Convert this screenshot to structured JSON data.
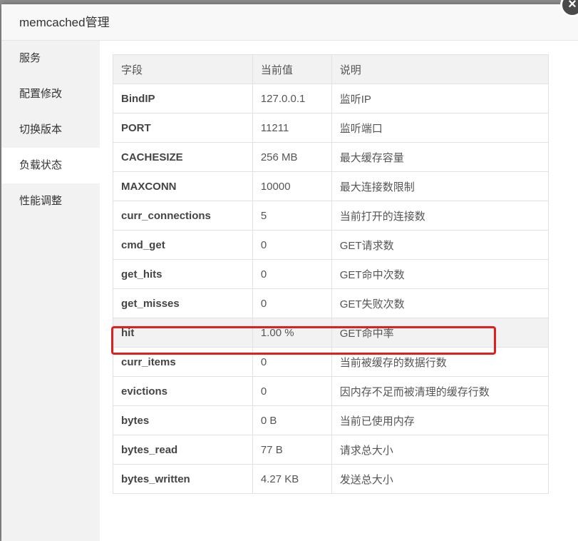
{
  "dialog": {
    "title": "memcached管理",
    "close_icon": "×"
  },
  "sidebar": {
    "items": [
      {
        "label": "服务"
      },
      {
        "label": "配置修改"
      },
      {
        "label": "切换版本"
      },
      {
        "label": "负载状态",
        "active": true
      },
      {
        "label": "性能调整"
      }
    ]
  },
  "table": {
    "headers": [
      "字段",
      "当前值",
      "说明"
    ],
    "rows": [
      {
        "field": "BindIP",
        "value": "127.0.0.1",
        "desc": "监听IP"
      },
      {
        "field": "PORT",
        "value": "11211",
        "desc": "监听端口"
      },
      {
        "field": "CACHESIZE",
        "value": "256 MB",
        "desc": "最大缓存容量"
      },
      {
        "field": "MAXCONN",
        "value": "10000",
        "desc": "最大连接数限制"
      },
      {
        "field": "curr_connections",
        "value": "5",
        "desc": "当前打开的连接数"
      },
      {
        "field": "cmd_get",
        "value": "0",
        "desc": "GET请求数"
      },
      {
        "field": "get_hits",
        "value": "0",
        "desc": "GET命中次数"
      },
      {
        "field": "get_misses",
        "value": "0",
        "desc": "GET失败次数"
      },
      {
        "field": "hit",
        "value": "1.00 %",
        "desc": "GET命中率"
      },
      {
        "field": "curr_items",
        "value": "0",
        "desc": "当前被缓存的数据行数"
      },
      {
        "field": "evictions",
        "value": "0",
        "desc": "因内存不足而被清理的缓存行数"
      },
      {
        "field": "bytes",
        "value": "0 B",
        "desc": "当前已使用内存"
      },
      {
        "field": "bytes_read",
        "value": "77 B",
        "desc": "请求总大小"
      },
      {
        "field": "bytes_written",
        "value": "4.27 KB",
        "desc": "发送总大小"
      }
    ]
  },
  "colors": {
    "highlight": "#e02020",
    "sidebar_bg": "#f2f2f2"
  }
}
